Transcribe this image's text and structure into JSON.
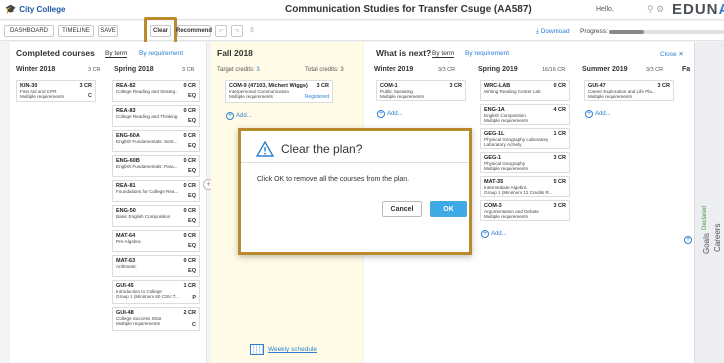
{
  "header": {
    "brand": "City College",
    "title": "Communication Studies for Transfer Csuge (AA587)",
    "greeting": "Hello,",
    "logo_main": "EDUN",
    "logo_accent": "AV"
  },
  "toolbar": {
    "dashboard": "DASHBOARD",
    "timeline": "TIMELINE",
    "save": "SAVE",
    "clear": "Clear",
    "recommend": "Recommend",
    "undo": "↶",
    "redo": "↷",
    "dollar": "$",
    "download": "Download",
    "progress": "Progress:"
  },
  "completed": {
    "title": "Completed courses",
    "tab_term": "By term",
    "tab_req": "By requirement",
    "terms": [
      {
        "name": "Winter 2018",
        "credits": "3 CR",
        "courses": [
          {
            "code": "KIN-30",
            "cr": "3 CR",
            "l1": "First Aid and CPR",
            "l2": "Multiple requirements",
            "tag": "C"
          }
        ]
      },
      {
        "name": "Spring 2018",
        "credits": "3 CR",
        "courses": [
          {
            "code": "REA-82",
            "cr": "0 CR",
            "l1": "College Reading and Strateg...",
            "l2": "",
            "tag": "EQ"
          },
          {
            "code": "REA-83",
            "cr": "0 CR",
            "l1": "College Reading and Thinking",
            "l2": "",
            "tag": "EQ"
          },
          {
            "code": "ENG-60A",
            "cr": "0 CR",
            "l1": "English Fundamentals: Sent...",
            "l2": "",
            "tag": "EQ"
          },
          {
            "code": "ENG-60B",
            "cr": "0 CR",
            "l1": "English Fundamentals: Para...",
            "l2": "",
            "tag": "EQ"
          },
          {
            "code": "REA-81",
            "cr": "0 CR",
            "l1": "Foundations for College Rea...",
            "l2": "",
            "tag": "EQ"
          },
          {
            "code": "ENG-50",
            "cr": "0 CR",
            "l1": "Basic English Composition",
            "l2": "",
            "tag": "EQ"
          },
          {
            "code": "MAT-64",
            "cr": "0 CR",
            "l1": "Pre-Algebra",
            "l2": "",
            "tag": "EQ"
          },
          {
            "code": "MAT-63",
            "cr": "0 CR",
            "l1": "Arithmetic",
            "l2": "",
            "tag": "EQ"
          },
          {
            "code": "GUI-45",
            "cr": "1 CR",
            "l1": "Introduction to College",
            "l2": "Group 1 (Minimum 60 CSU T...",
            "tag": "P"
          },
          {
            "code": "GUI-48",
            "cr": "2 CR",
            "l1": "College Success Strat",
            "l2": "Multiple requirements",
            "tag": "C"
          }
        ]
      }
    ]
  },
  "current": {
    "title": "Fall 2018",
    "target_label": "Target credits:",
    "target": "3",
    "total_label": "Total credits:",
    "total": "3",
    "course": {
      "code": "COM-9 (47103, Michert Wiggs)",
      "cr": "3 CR",
      "l1": "Interpersonal Communication",
      "l2": "Multiple requirements",
      "tag": "Registered"
    },
    "add": "Add...",
    "weekly": "Weekly schedule"
  },
  "next": {
    "title": "What is next?",
    "tab_term": "By term",
    "tab_req": "By requirement",
    "close": "Close ✕",
    "terms": [
      {
        "name": "Winter 2019",
        "credits": "3/3 CR",
        "courses": [
          {
            "code": "COM-1",
            "cr": "3 CR",
            "l1": "Public Speaking",
            "l2": "Multiple requirements"
          }
        ],
        "add": "Add..."
      },
      {
        "name": "Spring 2019",
        "credits": "16/16 CR",
        "courses": [
          {
            "code": "WRC-LAB",
            "cr": "0 CR",
            "l1": "Writing Reading Center Lab",
            "l2": ""
          },
          {
            "code": "ENG-1A",
            "cr": "4 CR",
            "l1": "English Composition",
            "l2": "Multiple requirements"
          },
          {
            "code": "GEG-1L",
            "cr": "1 CR",
            "l1": "Physical Geography Laboratory",
            "l2": "Laboratory Activity"
          },
          {
            "code": "GEG-1",
            "cr": "3 CR",
            "l1": "Physical Geography",
            "l2": "Multiple requirements"
          },
          {
            "code": "MAT-35",
            "cr": "5 CR",
            "l1": "Intermediate Algebra",
            "l2": "Group 1 (Minimum 12 Credits R..."
          },
          {
            "code": "COM-3",
            "cr": "3 CR",
            "l1": "Argumentation and Debate",
            "l2": "Multiple requirements"
          }
        ],
        "add": "Add..."
      },
      {
        "name": "Summer 2019",
        "credits": "3/3 CR",
        "courses": [
          {
            "code": "GUI-47",
            "cr": "3 CR",
            "l1": "Career Exploration and Life Pla...",
            "l2": "Multiple requirements"
          }
        ],
        "add": "Add..."
      },
      {
        "name": "Fa",
        "credits": "",
        "courses": [],
        "add": ""
      }
    ]
  },
  "sidebar": {
    "goals": "Goals",
    "declared": "Declared",
    "careers": "Careers"
  },
  "modal": {
    "title": "Clear the plan?",
    "message": "Click OK to remove all the courses from the plan.",
    "cancel": "Cancel",
    "ok": "OK"
  }
}
